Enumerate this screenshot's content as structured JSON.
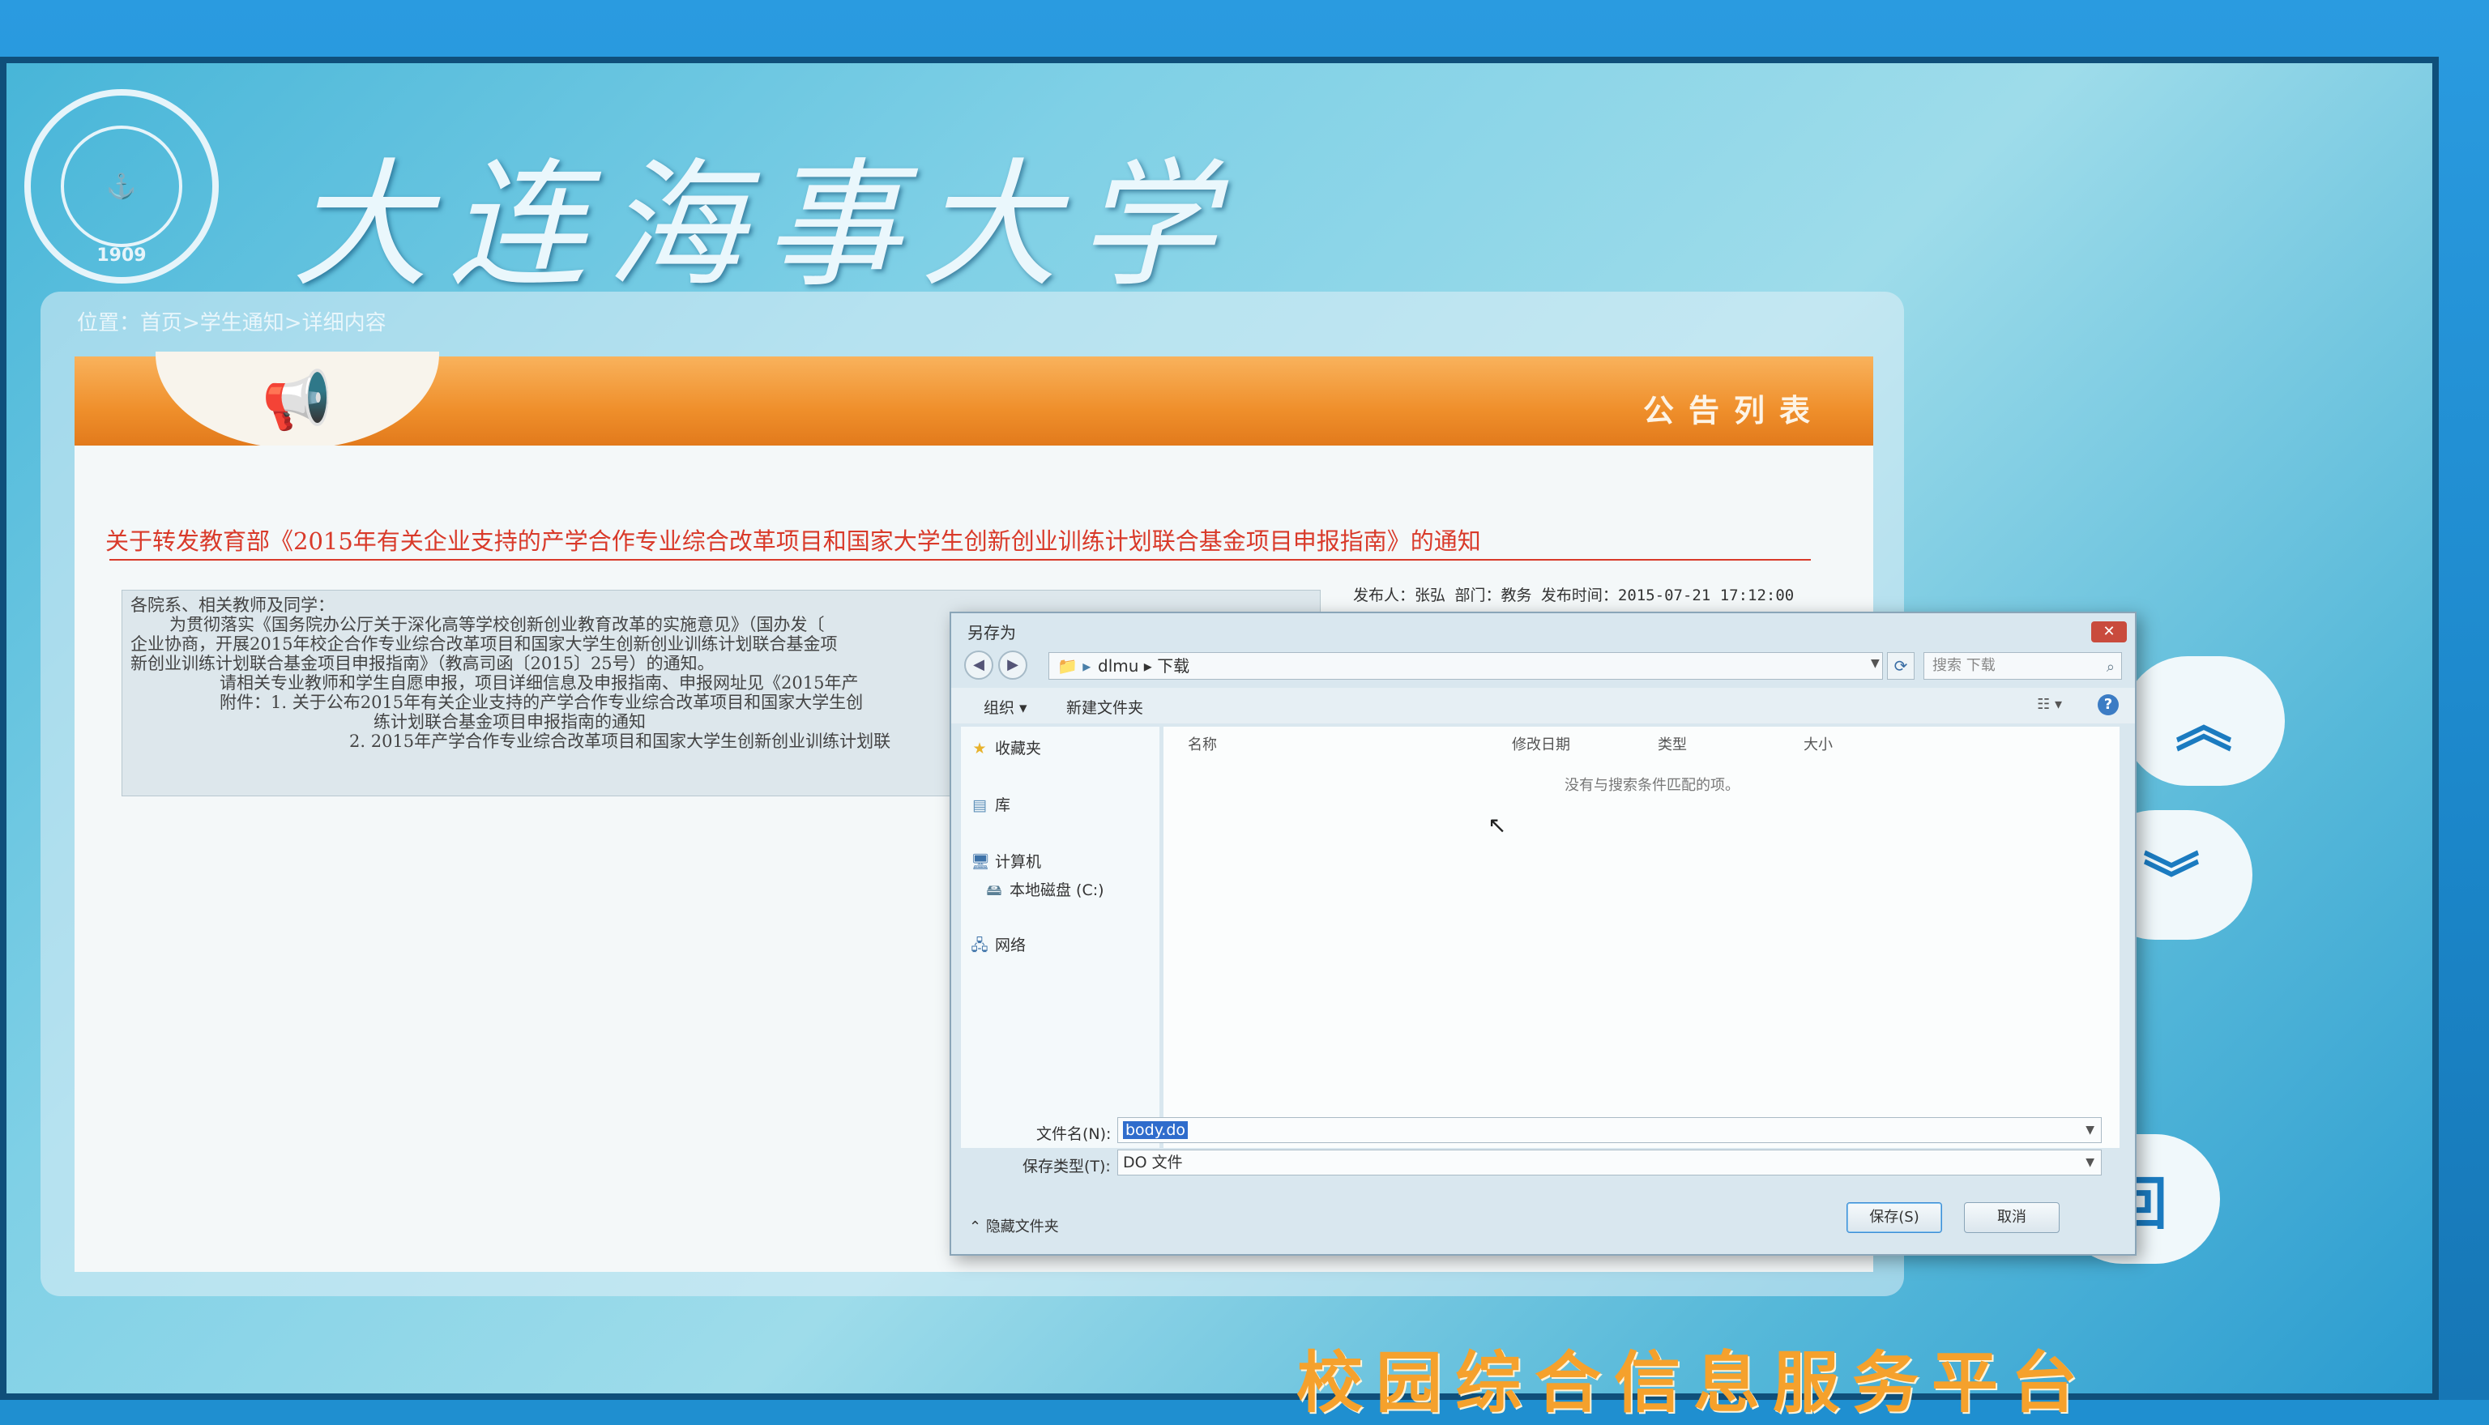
{
  "university": {
    "name": "大连海事大学",
    "logo_text": "大连海事大学",
    "logo_year": "1909"
  },
  "breadcrumb": "位置：首页>学生通知>详细内容",
  "banner": {
    "label": "公告列表",
    "icon": "megaphone-icon"
  },
  "notice": {
    "title": "关于转发教育部《2015年有关企业支持的产学合作专业综合改革项目和国家大学生创新创业训练计划联合基金项目申报指南》的通知",
    "meta": "发布人：张弘 部门：教务 发布时间：2015-07-21 17:12:00",
    "body_lines": [
      "各院系、相关教师及同学：",
      "为贯彻落实《国务院办公厅关于深化高等学校创新创业教育改革的实施意见》（国办发〔",
      "企业协商，开展2015年校企合作专业综合改革项目和国家大学生创新创业训练计划联合基金项",
      "新创业训练计划联合基金项目申报指南》（教高司函〔2015〕25号）的通知。",
      "请相关专业教师和学生自愿申报，项目详细信息及申报指南、申报网址见《2015年产",
      "附件：1. 关于公布2015年有关企业支持的产学合作专业综合改革项目和国家大学生创",
      "练计划联合基金项目申报指南的通知",
      "2. 2015年产学合作专业综合改革项目和国家大学生创新创业训练计划联"
    ]
  },
  "side_buttons": {
    "up": "︽",
    "down": "︾",
    "back": "回"
  },
  "footer_title": "校园综合信息服务平台",
  "dialog": {
    "title": "另存为",
    "close": "✕",
    "path": [
      "dlmu",
      "下载"
    ],
    "search_placeholder": "搜索 下载",
    "toolbar": {
      "organize": "组织 ▾",
      "new_folder": "新建文件夹"
    },
    "nav": {
      "favorites": "收藏夹",
      "libraries": "库",
      "computer": "计算机",
      "local_disk": "本地磁盘 (C:)",
      "network": "网络"
    },
    "columns": [
      "名称",
      "修改日期",
      "类型",
      "大小"
    ],
    "empty_message": "没有与搜索条件匹配的项。",
    "filename_label": "文件名(N):",
    "filename_value": "body.do",
    "filetype_label": "保存类型(T):",
    "filetype_value": "DO 文件",
    "hide_folders": "隐藏文件夹",
    "save_button": "保存(S)",
    "cancel_button": "取消"
  }
}
